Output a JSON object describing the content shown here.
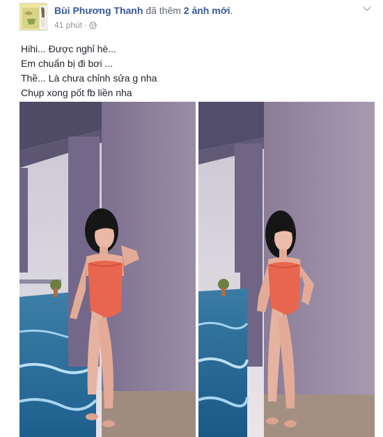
{
  "post": {
    "author": "Bùi Phương Thanh",
    "action_prefix": "đã thêm",
    "photo_count_text": "2 ảnh mới",
    "action_suffix": ".",
    "timestamp": "41 phút",
    "separator": "·",
    "privacy_icon": "globe-icon",
    "menu_icon": "chevron-down-icon",
    "text_lines": [
      "Hihi... Được nghỉ hè...",
      "Em chuẩn bị đi bơi ...",
      "Thề... Là chưa chỉnh sửa g nha",
      "Chụp xong pốt fb liền nha"
    ]
  },
  "colors": {
    "link": "#365899",
    "meta": "#90949c",
    "text": "#1d2129",
    "swimsuit": "#e8654e"
  }
}
